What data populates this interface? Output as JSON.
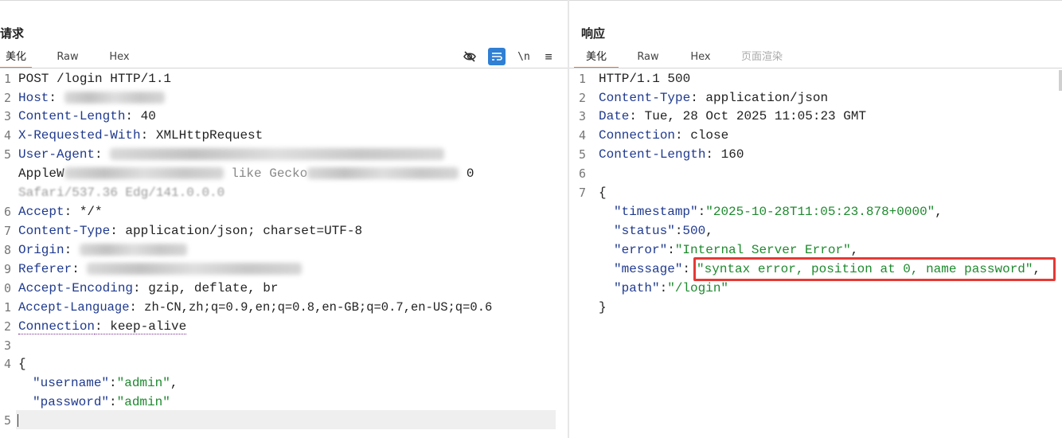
{
  "request": {
    "title": "请求",
    "tabs": [
      "美化",
      "Raw",
      "Hex"
    ],
    "tools": {
      "hide": "eye-slash-icon",
      "wrap": "wrap-icon",
      "newline": "\\n",
      "menu": "≡"
    },
    "lines": [
      {
        "num": "1",
        "key": "POST /login HTTP/1.1",
        "val": ""
      },
      {
        "num": "2",
        "key": "Host",
        "val": ""
      },
      {
        "num": "3",
        "key": "Content-Length",
        "val": " 40"
      },
      {
        "num": "4",
        "key": "X-Requested-With",
        "val": " XMLHttpRequest"
      },
      {
        "num": "5",
        "key": "User-Agent",
        "val": ""
      },
      {
        "num": "",
        "key": "",
        "val": "AppleW",
        "cont": "like Gecko",
        "tail": "0"
      },
      {
        "num": "",
        "key": "",
        "val": "Safari/537.36 Edg/141.0.0.0"
      },
      {
        "num": "6",
        "key": "Accept",
        "val": " */*"
      },
      {
        "num": "7",
        "key": "Content-Type",
        "val": " application/json; charset=UTF-8"
      },
      {
        "num": "8",
        "key": "Origin",
        "val": ""
      },
      {
        "num": "9",
        "key": "Referer",
        "val": ""
      },
      {
        "num": "0",
        "key": "Accept-Encoding",
        "val": " gzip, deflate, br"
      },
      {
        "num": "1",
        "key": "Accept-Language",
        "val": " zh-CN,zh;q=0.9,en;q=0.8,en-GB;q=0.7,en-US;q=0.6"
      },
      {
        "num": "2",
        "key": "Connection",
        "val": " keep-alive"
      },
      {
        "num": "3",
        "key": "",
        "val": ""
      },
      {
        "num": "4",
        "key": "",
        "val": "{"
      }
    ],
    "body": {
      "username_key": "\"username\"",
      "username_val": "\"admin\"",
      "password_key": "\"password\"",
      "password_val": "\"admin\""
    },
    "last_line_num": "5"
  },
  "response": {
    "title": "响应",
    "tabs": [
      "美化",
      "Raw",
      "Hex",
      "页面渲染"
    ],
    "headers": [
      {
        "num": "1",
        "key": "HTTP/1.1 500",
        "val": ""
      },
      {
        "num": "2",
        "key": "Content-Type",
        "val": " application/json"
      },
      {
        "num": "3",
        "key": "Date",
        "val": " Tue, 28 Oct 2025 11:05:23 GMT"
      },
      {
        "num": "4",
        "key": "Connection",
        "val": " close"
      },
      {
        "num": "5",
        "key": "Content-Length",
        "val": " 160"
      },
      {
        "num": "6",
        "key": "",
        "val": ""
      },
      {
        "num": "7",
        "key": "",
        "val": "{"
      }
    ],
    "json": [
      {
        "key": "\"timestamp\"",
        "val": "\"2025-10-28T11:05:23.878+0000\"",
        "is_str": true
      },
      {
        "key": "\"status\"",
        "val": "500",
        "is_str": false
      },
      {
        "key": "\"error\"",
        "val": "\"Internal Server Error\"",
        "is_str": true
      },
      {
        "key": "\"message\"",
        "val": "\"syntax error, position at 0, name password\"",
        "is_str": true
      },
      {
        "key": "\"path\"",
        "val": "\"/login\"",
        "is_str": true
      }
    ],
    "close_brace": "}",
    "highlight_color": "#e53935"
  }
}
